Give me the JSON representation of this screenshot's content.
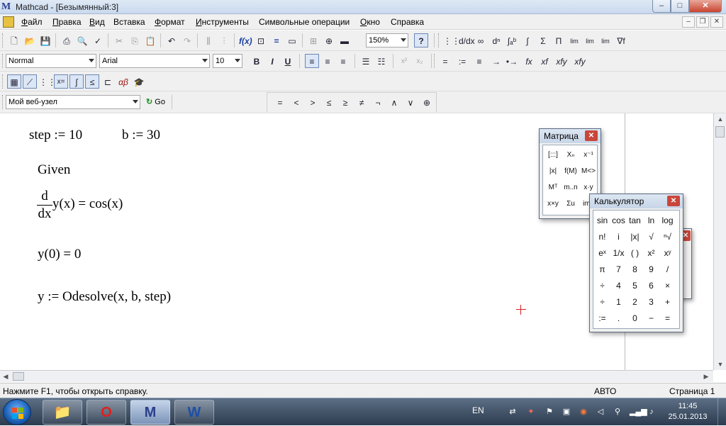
{
  "window": {
    "title": "Mathcad - [Безымянный:3]",
    "logo_letter": "M",
    "minimize_glyph": "–",
    "maximize_glyph": "□",
    "close_glyph": "✕"
  },
  "menu": {
    "items": [
      {
        "ul": "Ф",
        "rest": "айл"
      },
      {
        "ul": "П",
        "rest": "равка"
      },
      {
        "ul": "В",
        "rest": "ид"
      },
      {
        "ul": "",
        "rest": "Вставка"
      },
      {
        "ul": "Ф",
        "rest": "ормат"
      },
      {
        "ul": "И",
        "rest": "нструменты"
      },
      {
        "ul": "",
        "rest": "Символьные операции"
      },
      {
        "ul": "О",
        "rest": "кно"
      },
      {
        "ul": "",
        "rest": "Справка"
      }
    ],
    "doc_min": "–",
    "doc_restore": "❐",
    "doc_close": "✕"
  },
  "toolbar_standard": {
    "zoom_value": "150%",
    "help_glyph": "?"
  },
  "toolbar_symbolic": [
    "→",
    "•→",
    "fx",
    "xf",
    "xfy",
    "xfy"
  ],
  "toolbar_symbolic_icons": [
    "∫",
    "Σ",
    "Π",
    "lim",
    "lim",
    "lim",
    "∇f"
  ],
  "toolbar_format": {
    "style": "Normal",
    "font": "Arial",
    "size": "10",
    "bold": "B",
    "italic": "I",
    "underline": "U",
    "sup": "x²",
    "sub": "x₂",
    "eq_symbols": [
      "=",
      ":=",
      "≡"
    ]
  },
  "toolbar_resources": {
    "url": "Мой веб-узел",
    "go": "Go"
  },
  "toolbar_boolean": [
    "=",
    "<",
    ">",
    "≤",
    "≥",
    "≠",
    "¬",
    "∧",
    "∨",
    "⊕"
  ],
  "toolbar_math_icons": [
    "calculator-icon",
    "graph-icon",
    "matrix-icon",
    "evaluation-icon",
    "calculus-icon",
    "boolean-icon",
    "programming-icon",
    "greek-icon",
    "symbolic-icon"
  ],
  "worksheet": {
    "line1_a": "step := 10",
    "line1_b": "b := 30",
    "given": "Given",
    "deriv_num": "d",
    "deriv_den": "dx",
    "deriv_expr": "y(x) = cos(x)",
    "init": "y(0) = 0",
    "solve": "y := Odesolve(x, b, step)"
  },
  "matrix_palette": {
    "title": "Матрица",
    "buttons": [
      "[:::]",
      "Xₙ",
      "x⁻¹",
      "|x|",
      "f(M)",
      "M<>",
      "Mᵀ",
      "m..n",
      "x·y",
      "x×y",
      "Σu",
      "img"
    ]
  },
  "calculator_palette": {
    "title": "Калькулятор",
    "buttons": [
      "sin",
      "cos",
      "tan",
      "ln",
      "log",
      "n!",
      "i",
      "|x|",
      "√",
      "ⁿ√",
      "eˣ",
      "1/x",
      "( )",
      "x²",
      "xʸ",
      "π",
      "7",
      "8",
      "9",
      "/",
      "÷",
      "4",
      "5",
      "6",
      "×",
      "÷",
      "1",
      "2",
      "3",
      "+",
      ":=",
      ".",
      "0",
      "−",
      "="
    ]
  },
  "statusbar": {
    "hint": "Нажмите F1, чтобы открыть справку.",
    "mode": "АВТО",
    "page": "Страница 1"
  },
  "taskbar": {
    "lang": "EN",
    "time": "11:45",
    "date": "25.01.2013",
    "tasks": [
      {
        "name": "explorer",
        "glyph": "📁"
      },
      {
        "name": "opera",
        "glyph": "O"
      },
      {
        "name": "mathcad",
        "glyph": "M"
      },
      {
        "name": "word",
        "glyph": "W"
      }
    ]
  },
  "colors": {
    "cursor": "#d82020",
    "taskbar": "#2c3b4f",
    "close_red": "#c9463a"
  }
}
